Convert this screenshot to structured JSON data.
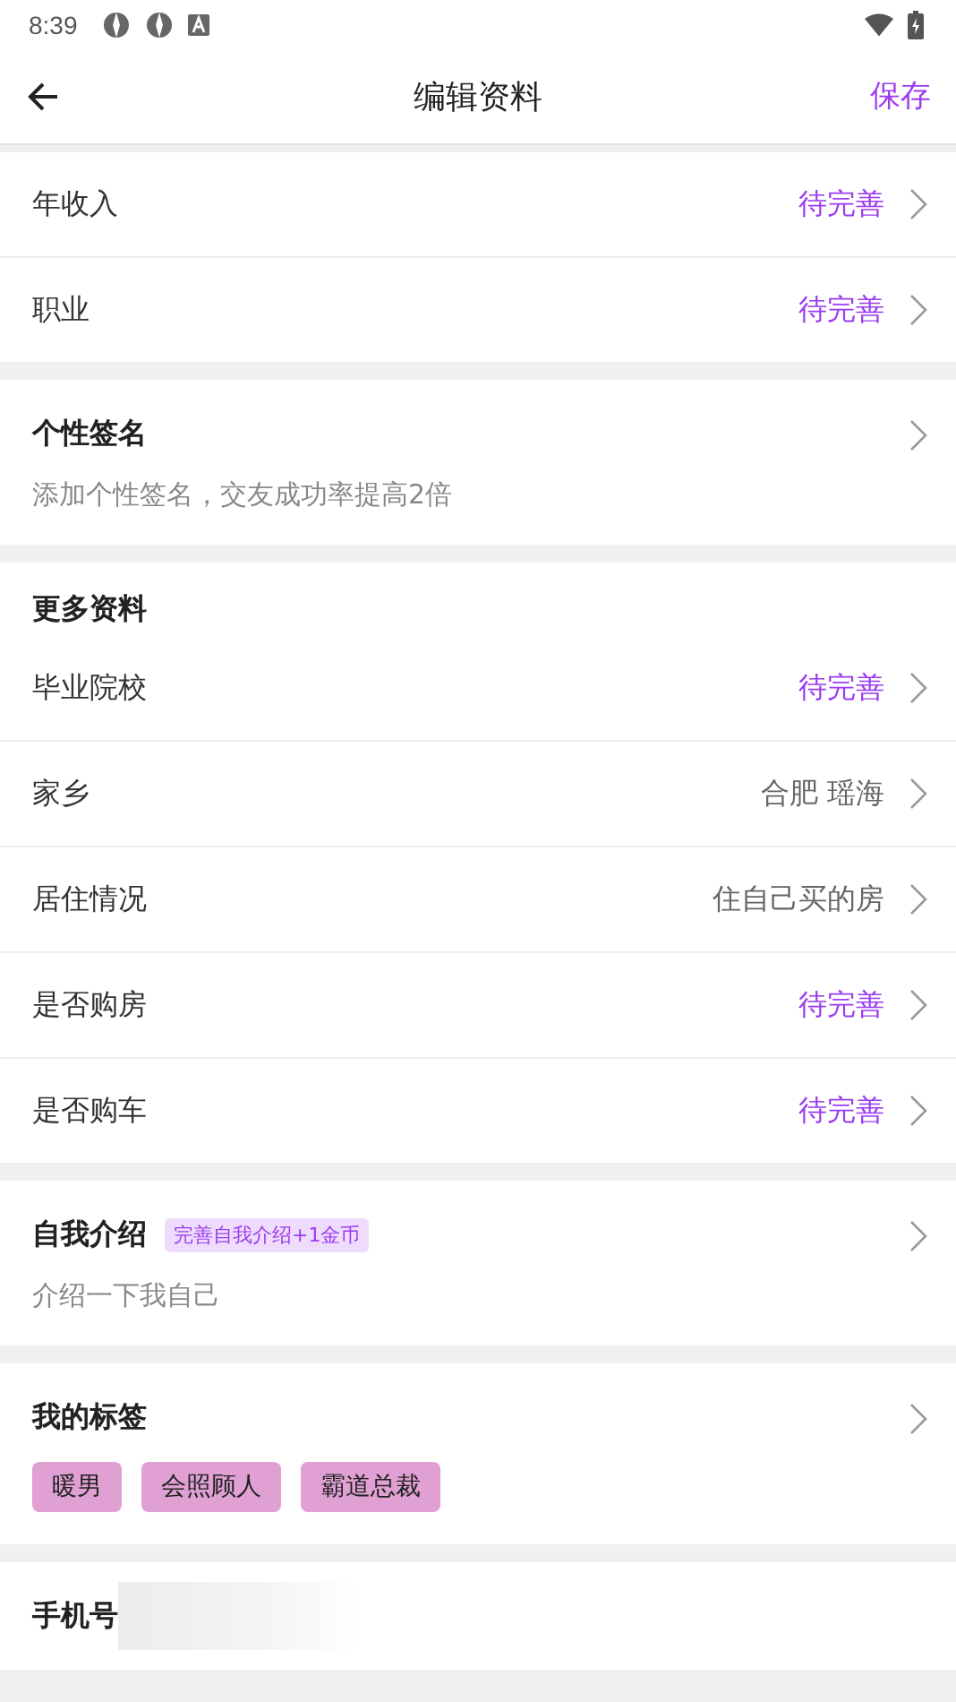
{
  "status_bar": {
    "time": "8:39"
  },
  "header": {
    "title": "编辑资料",
    "action": "保存"
  },
  "sections": [
    {
      "kind": "rows",
      "rows": [
        {
          "label": "年收入",
          "value": "待完善",
          "pending": true
        },
        {
          "label": "职业",
          "value": "待完善",
          "pending": true
        }
      ]
    },
    {
      "kind": "text",
      "title": "个性签名",
      "hint": "添加个性签名，交友成功率提高2倍"
    },
    {
      "kind": "rows",
      "heading": "更多资料",
      "rows": [
        {
          "label": "毕业院校",
          "value": "待完善",
          "pending": true
        },
        {
          "label": "家乡",
          "value": "合肥 瑶海",
          "pending": false
        },
        {
          "label": "居住情况",
          "value": "住自己买的房",
          "pending": false
        },
        {
          "label": "是否购房",
          "value": "待完善",
          "pending": true
        },
        {
          "label": "是否购车",
          "value": "待完善",
          "pending": true
        }
      ]
    },
    {
      "kind": "text",
      "title": "自我介绍",
      "badge": "完善自我介绍+1金币",
      "hint": "介绍一下我自己"
    },
    {
      "kind": "tags",
      "title": "我的标签",
      "tags": [
        "暖男",
        "会照顾人",
        "霸道总裁"
      ]
    },
    {
      "kind": "phone",
      "title": "手机号"
    }
  ]
}
